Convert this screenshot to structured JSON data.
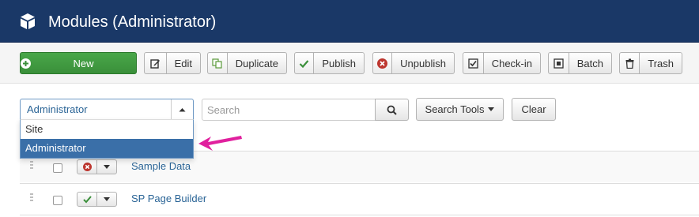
{
  "header": {
    "title": "Modules (Administrator)",
    "icon": "cube-icon"
  },
  "toolbar": {
    "new": "New",
    "edit": "Edit",
    "duplicate": "Duplicate",
    "publish": "Publish",
    "unpublish": "Unpublish",
    "checkin": "Check-in",
    "batch": "Batch",
    "trash": "Trash"
  },
  "filters": {
    "client_select": {
      "value": "Administrator",
      "options": [
        "Site",
        "Administrator"
      ]
    },
    "search_placeholder": "Search",
    "search_tools": "Search Tools",
    "clear": "Clear"
  },
  "rows": [
    {
      "name": "Sample Data",
      "status": "unpublished"
    },
    {
      "name": "SP Page Builder",
      "status": "published"
    }
  ],
  "colors": {
    "header_bg": "#1a3867",
    "new_button": "#46a546",
    "link": "#2a6496",
    "selected_option": "#3a6fa8",
    "pointer": "#e0209e"
  }
}
